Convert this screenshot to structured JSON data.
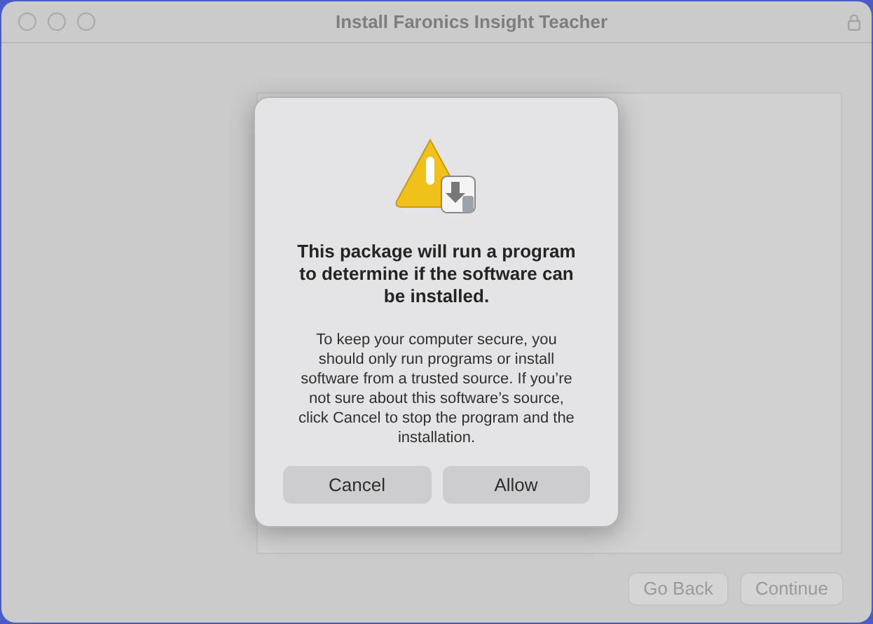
{
  "window": {
    "title": "Install Faronics Insight Teacher"
  },
  "footer_buttons": [
    "Go Back",
    "Continue"
  ],
  "dialog": {
    "heading": "This package will run a program to determine if the software can be installed.",
    "message": "To keep your computer secure, you should only run programs or install software from a trusted source. If you’re not sure about this software’s source, click Cancel to stop the program and the installation.",
    "buttons": [
      "Cancel",
      "Allow"
    ]
  }
}
